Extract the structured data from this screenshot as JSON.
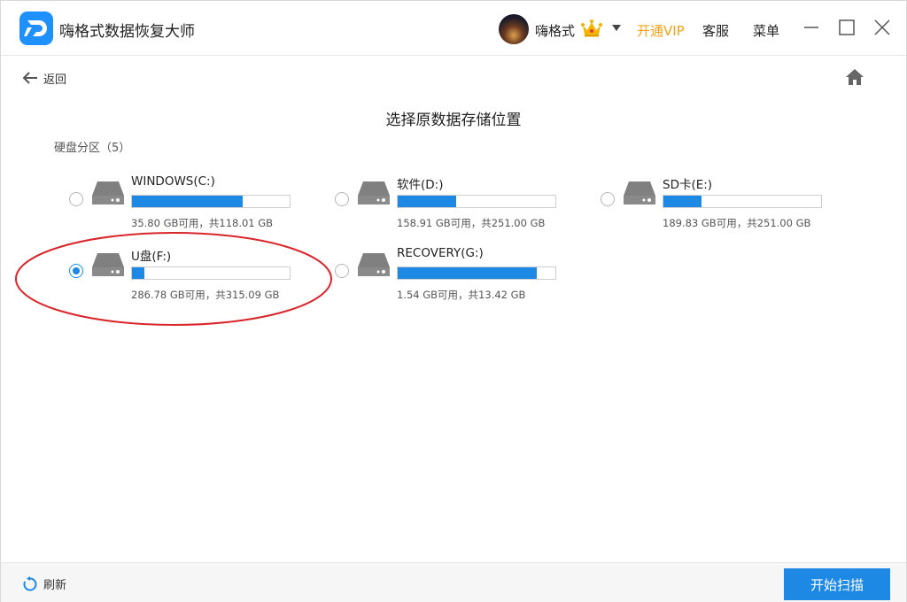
{
  "app": {
    "title": "嗨格式数据恢复大师"
  },
  "header": {
    "user_name": "嗨格式",
    "vip_label": "开通VIP",
    "service_label": "客服",
    "menu_label": "菜单"
  },
  "nav": {
    "back_label": "返回"
  },
  "page": {
    "title": "选择原数据存储位置",
    "section_label": "硬盘分区（5）"
  },
  "drives": [
    {
      "name": "WINDOWS(C:)",
      "size_text": "35.80 GB可用，共118.01 GB",
      "used_fraction": 0.7,
      "selected": false
    },
    {
      "name": "软件(D:)",
      "size_text": "158.91 GB可用，共251.00 GB",
      "used_fraction": 0.37,
      "selected": false
    },
    {
      "name": "SD卡(E:)",
      "size_text": "189.83 GB可用，共251.00 GB",
      "used_fraction": 0.24,
      "selected": false
    },
    {
      "name": "U盘(F:)",
      "size_text": "286.78 GB可用，共315.09 GB",
      "used_fraction": 0.08,
      "selected": true
    },
    {
      "name": "RECOVERY(G:)",
      "size_text": "1.54 GB可用，共13.42 GB",
      "used_fraction": 0.88,
      "selected": false
    }
  ],
  "footer": {
    "refresh_label": "刷新",
    "scan_label": "开始扫描"
  },
  "colors": {
    "accent": "#1e88e5",
    "vip": "#f3a21a",
    "annotation": "#d9262b"
  }
}
